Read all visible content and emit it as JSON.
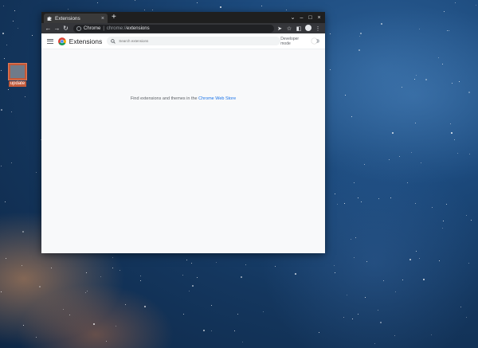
{
  "desktop": {
    "icon_label": "update"
  },
  "browser": {
    "tab_title": "Extensions",
    "tab_close": "×",
    "new_tab": "+",
    "window_controls": [
      "⌄",
      "–",
      "□",
      "×"
    ],
    "address": {
      "scheme": "Chrome",
      "separator": "|",
      "host": "chrome://",
      "path": "extensions"
    }
  },
  "page": {
    "title": "Extensions",
    "search_placeholder": "Search extensions",
    "developer_mode_label": "Developer mode",
    "developer_mode_on": false,
    "empty_text": "Find extensions and themes in the",
    "store_link": "Chrome Web Store"
  },
  "colors": {
    "link": "#1a73e8",
    "titlebar": "#1f1f1f",
    "toolbar": "#35363a"
  }
}
